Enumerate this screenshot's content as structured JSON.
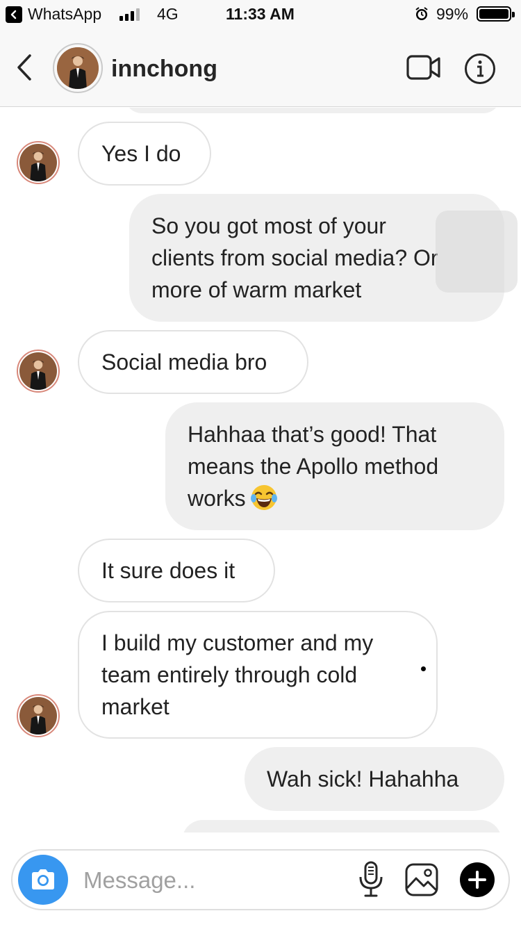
{
  "status_bar": {
    "back_app": "WhatsApp",
    "network": "4G",
    "time": "11:33 AM",
    "battery": "99%",
    "battery_level": 0.99
  },
  "header": {
    "username": "innchong",
    "back_icon": "chevron-left-icon",
    "video_icon": "video-camera-icon",
    "info_icon": "info-icon"
  },
  "messages": [
    {
      "direction": "incoming",
      "text": "Yes I do"
    },
    {
      "direction": "outgoing",
      "text": "So you got most of your\nclients from social media? Or\nmore of warm market"
    },
    {
      "direction": "incoming",
      "text": "Social media bro"
    },
    {
      "direction": "outgoing",
      "text": "Hahhaa that’s good! That\nmeans the Apollo method\nworks",
      "emoji": "face-with-tears-of-joy"
    },
    {
      "direction": "incoming",
      "text": "It sure does it"
    },
    {
      "direction": "incoming",
      "text": "I build my customer and my\nteam entirely through cold\nmarket"
    },
    {
      "direction": "outgoing",
      "text": "Wah sick! Hahahha"
    }
  ],
  "composer": {
    "placeholder": "Message...",
    "camera_icon": "camera-icon",
    "mic_icon": "microphone-icon",
    "gallery_icon": "image-icon",
    "plus_icon": "plus-icon"
  },
  "colors": {
    "accent": "#3897f0",
    "incoming_bubble": "#ffffff",
    "outgoing_bubble": "#efefef",
    "avatar_ring": "#d8887a"
  }
}
